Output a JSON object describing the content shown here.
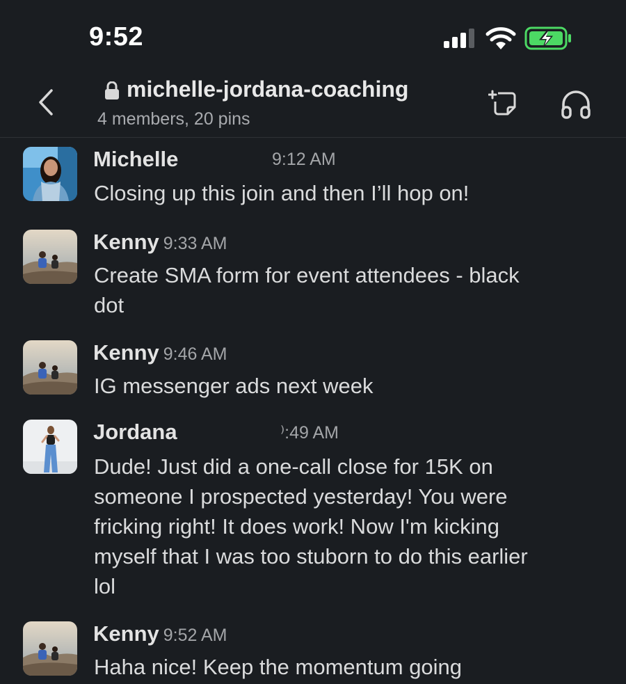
{
  "status_bar": {
    "time": "9:52",
    "signal_icon": "cellular-signal-icon",
    "wifi_icon": "wifi-icon",
    "battery_icon": "battery-charging-icon",
    "battery_color": "#4cd964"
  },
  "channel": {
    "name": "michelle-jordana-coaching",
    "meta": "4 members, 20 pins",
    "private": true,
    "back_icon": "chevron-left-icon",
    "canvas_icon": "new-canvas-icon",
    "huddle_icon": "headphones-icon"
  },
  "messages": [
    {
      "sender": "Michelle",
      "time": "9:12 AM",
      "lines": [
        "Closing up this join and then I’ll hop on!"
      ]
    },
    {
      "sender": "Kenny",
      "time": "9:33 AM",
      "lines": [
        "Create SMA form for event attendees - black",
        "dot"
      ]
    },
    {
      "sender": "Kenny",
      "time": "9:46 AM",
      "lines": [
        "IG messenger ads next week"
      ]
    },
    {
      "sender": "Jordana",
      "time": "⁾:49 AM",
      "lines": [
        "Dude! Just did a one-call close for 15K on",
        "someone I prospected yesterday! You were",
        "fricking right! It does work! Now I'm kicking",
        "myself that I was too stuborn to do this earlier",
        "lol"
      ]
    },
    {
      "sender": "Kenny",
      "time": "9:52 AM",
      "lines": [
        "Haha nice! Keep the momentum going"
      ]
    }
  ]
}
